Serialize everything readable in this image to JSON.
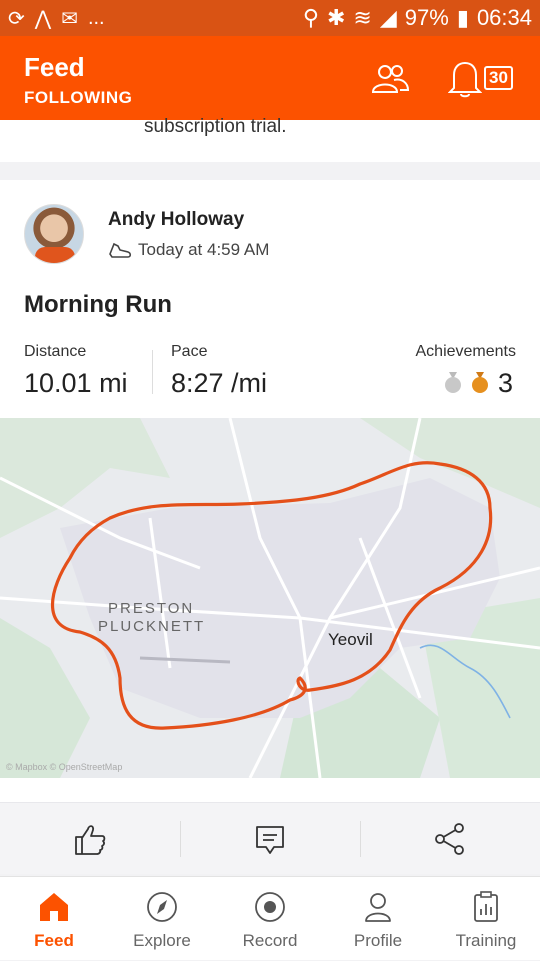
{
  "status_bar": {
    "battery": "97%",
    "time": "06:34",
    "notification_dots": "..."
  },
  "header": {
    "title": "Feed",
    "subtitle": "FOLLOWING",
    "notification_count": "30"
  },
  "previous_card": {
    "text": "subscription trial."
  },
  "activity": {
    "athlete": "Andy Holloway",
    "time": "Today at 4:59 AM",
    "title": "Morning Run",
    "stats": [
      {
        "label": "Distance",
        "value": "10.01 mi"
      },
      {
        "label": "Pace",
        "value": "8:27 /mi"
      },
      {
        "label": "Achievements",
        "value": "3"
      }
    ],
    "map": {
      "area_label_1": "PRESTON",
      "area_label_2": "PLUCKNETT",
      "town": "Yeovil",
      "credit": "© Mapbox © OpenStreetMap"
    }
  },
  "colors": {
    "brand": "#fc5200",
    "status_bar": "#d95314",
    "route": "#e4501a"
  },
  "nav": [
    {
      "label": "Feed",
      "icon": "home-icon",
      "active": true
    },
    {
      "label": "Explore",
      "icon": "compass-icon",
      "active": false
    },
    {
      "label": "Record",
      "icon": "record-icon",
      "active": false
    },
    {
      "label": "Profile",
      "icon": "profile-icon",
      "active": false
    },
    {
      "label": "Training",
      "icon": "training-icon",
      "active": false
    }
  ]
}
